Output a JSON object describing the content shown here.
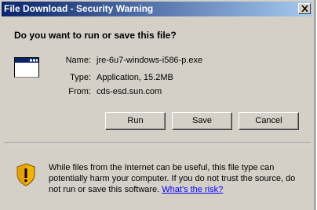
{
  "window": {
    "title": "File Download - Security Warning",
    "close_symbol": "×"
  },
  "dialog": {
    "question": "Do you want to run or save this file?",
    "file_icon": "application-window-icon",
    "info": [
      {
        "label": "Name:",
        "value": "jre-6u7-windows-i586-p.exe"
      },
      {
        "label": "Type:",
        "value": "Application, 15.2MB"
      },
      {
        "label": "From:",
        "value": "cds-esd.sun.com"
      }
    ],
    "buttons": {
      "run": "Run",
      "save": "Save",
      "cancel": "Cancel"
    },
    "warning": {
      "icon": "shield-warning-icon",
      "text": "While files from the Internet can be useful, this file type can potentially harm your computer. If you do not trust the source, do not run or save this software.",
      "link": "What's the risk?"
    }
  },
  "colors": {
    "titlebar_start": "#0a246a",
    "titlebar_end": "#a6caf0",
    "dialog_bg": "#d4d0c8",
    "link": "#0000ff"
  }
}
